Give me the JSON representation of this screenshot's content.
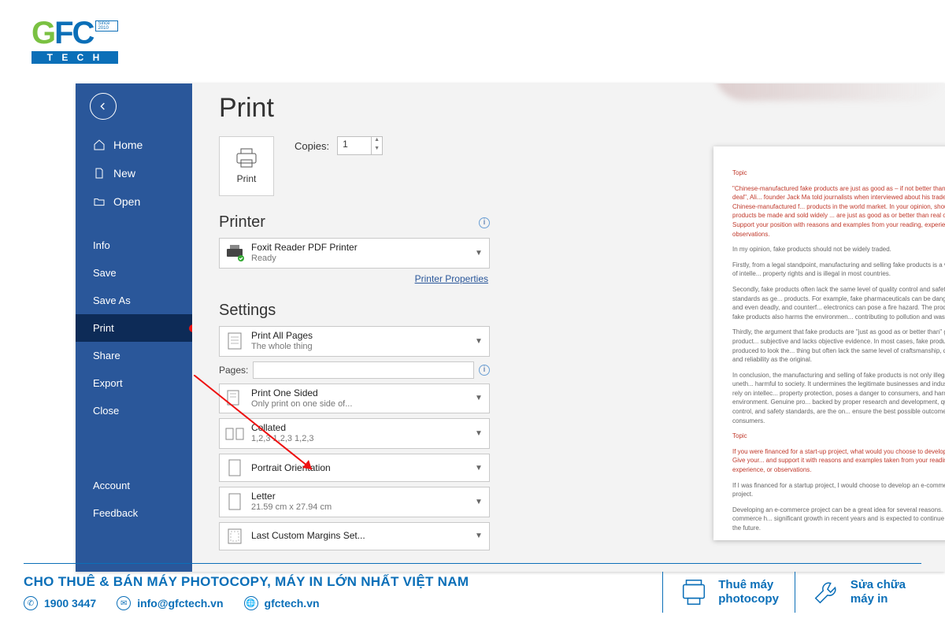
{
  "logo": {
    "gfc_g": "G",
    "gfc_fc": "FC",
    "since": "Since 2010",
    "tech": "T E C H"
  },
  "sidebar": {
    "home": "Home",
    "new": "New",
    "open": "Open",
    "info": "Info",
    "save": "Save",
    "saveas": "Save As",
    "print": "Print",
    "share": "Share",
    "export": "Export",
    "close": "Close",
    "account": "Account",
    "feedback": "Feedback"
  },
  "pane": {
    "title": "Print",
    "print_btn": "Print",
    "copies_label": "Copies:",
    "copies_value": "1",
    "printer_head": "Printer",
    "printer_name": "Foxit Reader PDF Printer",
    "printer_status": "Ready",
    "printer_props": "Printer Properties",
    "settings_head": "Settings",
    "s_all_t1": "Print All Pages",
    "s_all_t2": "The whole thing",
    "pages_label": "Pages:",
    "s_oneside_t1": "Print One Sided",
    "s_oneside_t2": "Only print on one side of...",
    "s_coll_t1": "Collated",
    "s_coll_t2": "1,2,3    1,2,3    1,2,3",
    "s_orient": "Portrait Orientation",
    "s_letter_t1": "Letter",
    "s_letter_t2": "21.59 cm x 27.94 cm",
    "s_margins": "Last Custom Margins Set..."
  },
  "preview": {
    "topic": "Topic",
    "q1": "\"Chinese-manufactured fake products are just as good as – if not better than the real deal\", Ali... founder Jack Ma told journalists when interviewed about his trade of Chinese-manufactured f... products in the world market. In your opinion, should fake products be made and sold widely ... are just as good as or better than real ones? Support your position with reasons and examples from your reading, experience, or observations.",
    "p1": "In my opinion, fake products should not be widely traded.",
    "p2": "Firstly, from a legal standpoint, manufacturing and selling fake products is a violation of intelle... property rights and is illegal in most countries.",
    "p3": "Secondly, fake products often lack the same level of quality control and safety standards as ge... products. For example, fake pharmaceuticals can be dangerous and even deadly, and counterf... electronics can pose a fire hazard. The production of fake products also harms the environmen... contributing to pollution and waste.",
    "p4": "Thirdly, the argument that fake products are \"just as good as or better than\" genuine product... subjective and lacks objective evidence. In most cases, fake products are produced to look the... thing but often lack the same level of craftsmanship, durability, and reliability as the original.",
    "p5": "In conclusion, the manufacturing and selling of fake products is not only illegal but also uneth... harmful to society. It undermines the legitimate businesses and industries that rely on intellec... property protection, poses a danger to consumers, and harms the environment. Genuine pro... backed by proper research and development, quality control, and safety standards, are the on... ensure the best possible outcomes for consumers.",
    "topic2": "Topic",
    "q2": "If you were financed for a start-up project, what would you choose to develop? Why? Give your... and support it with reasons and examples taken from your reading, experience, or observations.",
    "p6": "If I was financed for a startup project, I would choose to develop an e-commerce project.",
    "p7": "Developing an e-commerce project can be a great idea for several reasons. Firstly, e-commerce h... significant growth in recent years and is expected to continue to grow in the future."
  },
  "footer": {
    "tagline": "CHO THUÊ & BÁN MÁY PHOTOCOPY, MÁY IN LỚN NHẤT VIỆT NAM",
    "phone": "1900 3447",
    "email": "info@gfctech.vn",
    "site": "gfctech.vn",
    "box1a": "Thuê máy",
    "box1b": "photocopy",
    "box2a": "Sửa chữa",
    "box2b": "máy in"
  }
}
